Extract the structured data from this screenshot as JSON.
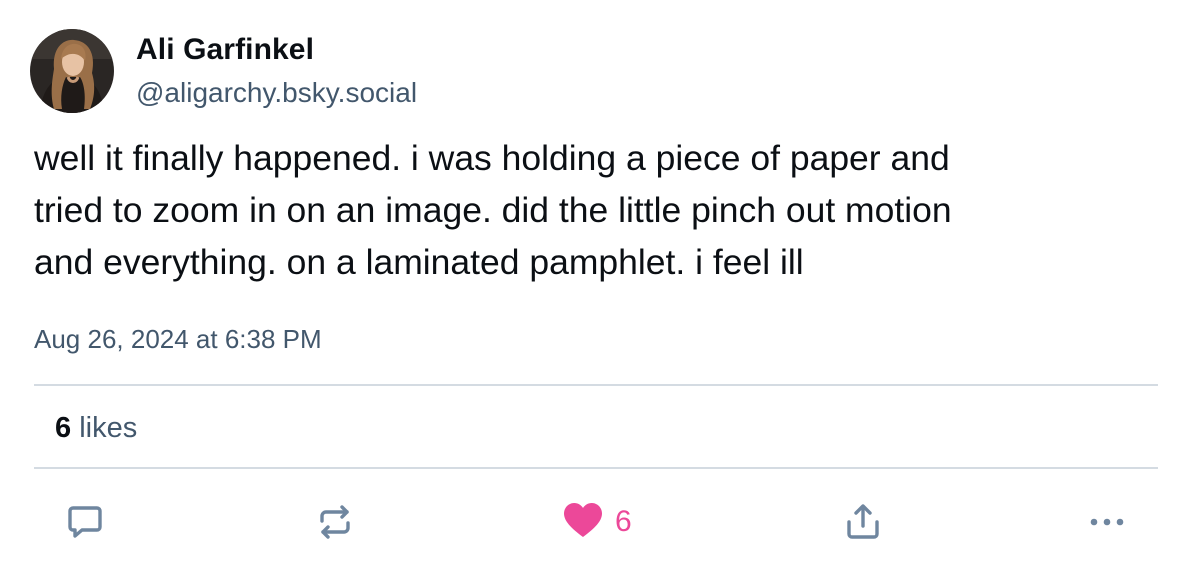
{
  "author": {
    "display_name": "Ali Garfinkel",
    "handle": "@aligarchy.bsky.social",
    "avatar_icon": "user-avatar-photo"
  },
  "post": {
    "text": "well it finally happened. i was holding a piece of paper and\ntried to zoom in on an image. did the little pinch out motion\nand everything. on a laminated pamphlet. i feel ill",
    "timestamp": "Aug 26, 2024 at 6:38 PM"
  },
  "stats": {
    "likes_count": "6",
    "likes_label": "likes"
  },
  "actions": {
    "reply_icon": "speech-bubble-icon",
    "repost_icon": "repost-arrows-icon",
    "like_icon": "heart-icon",
    "like_count": "6",
    "share_icon": "share-upload-icon",
    "more_icon": "ellipsis-icon"
  },
  "colors": {
    "primary_text": "#0b0f14",
    "secondary_text": "#42576c",
    "divider": "#d4dbe2",
    "like_pink": "#ec4899",
    "action_blue": "#6f869f"
  }
}
